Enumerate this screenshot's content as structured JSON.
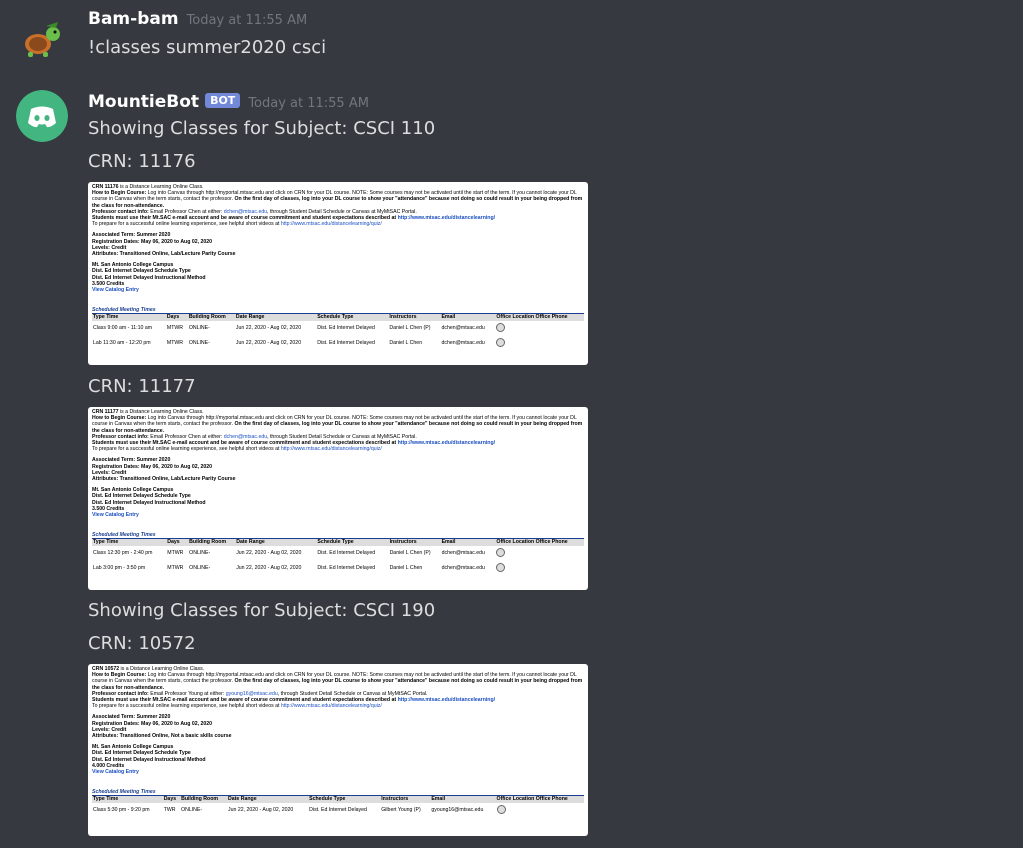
{
  "messages": [
    {
      "author": "Bam-bam",
      "timestamp": "Today at 11:55 AM",
      "text": "!classes summer2020 csci"
    },
    {
      "author": "MountieBot",
      "badge": "BOT",
      "timestamp": "Today at 11:55 AM"
    }
  ],
  "headings": {
    "s1": "Showing Classes for Subject: CSCI 110",
    "c1": "CRN: 11176",
    "c2": "CRN: 11177",
    "s2": "Showing Classes for Subject: CSCI 190",
    "c3": "CRN: 10572"
  },
  "embed_common": {
    "how_begin_label": "How to Begin Course:",
    "how_begin_text": " Log into Canvas through http://myportal.mtsac.edu and click on CRN for your DL course. NOTE: Some courses may not be activated until the start of the term. If you cannot locate your DL course in Canvas when the term starts, contact the professor. ",
    "first_day": "On the first day of classes, log into your DL course to show your \"attendance\" because not doing so could result in your being dropped from the class for non-attendance.",
    "contact_label": "Professor contact info:",
    "students_must": "Students must use their Mt.SAC e-mail account and be aware of course commitment and student expectations described at ",
    "dl_link": "http://www.mtsac.edu/distancelearning/",
    "prepare": "To prepare for a successful online learning experience, see helpful short videos at ",
    "quiz_link": "http://www.mtsac.edu/distancelearning/quiz/",
    "assoc_term": "Associated Term: Summer 2020",
    "reg_dates": "Registration Dates: May 06, 2020 to Aug 02, 2020",
    "levels": "Levels: Credit",
    "campus": "Mt. San Antonio College Campus",
    "view_catalog": "View Catalog Entry",
    "sched_title": "Scheduled Meeting Times",
    "date_range": "Jun 22, 2020 - Aug 02, 2020",
    "headers": [
      "Type",
      "Time",
      "Days",
      "Building",
      "Room",
      "Date Range",
      "Schedule Type",
      "Instructors",
      "Email",
      "Office Location",
      "Office Phone"
    ]
  },
  "embeds": [
    {
      "crn_bold": "CRN 11176",
      "crn_rest": " is a Distance Learning Online Class.",
      "contact_text": " Email Professor Chen at either: ",
      "prof_email": "dchen@mtsac.edu",
      "contact_rest": ", through Student Detail Schedule or Canvas at MyMtSAC Portal.",
      "attributes": "Attributes: Transitioned Online, Lab/Lecture Parity Course",
      "dl_type1": "Dist. Ed Internet Delayed Schedule Type",
      "dl_type2": "Dist. Ed Internet Delayed Instructional Method",
      "credits": "3.500 Credits",
      "rows": [
        {
          "type": "Class",
          "time": "9:00 am - 11:10 am",
          "days": "MTWR",
          "building": "ONLINE-",
          "sched": "Dist. Ed Internet Delayed",
          "instr": "Daniel L Chen (P)",
          "email": "dchen@mtsac.edu"
        },
        {
          "type": "Lab",
          "time": "11:30 am - 12:20 pm",
          "days": "MTWR",
          "building": "ONLINE-",
          "sched": "Dist. Ed Internet Delayed",
          "instr": "Daniel L Chen",
          "email": "dchen@mtsac.edu"
        }
      ]
    },
    {
      "crn_bold": "CRN 11177",
      "crn_rest": " is a Distance Learning Online Class.",
      "contact_text": " Email Professor Chen at either: ",
      "prof_email": "dchen@mtsac.edu",
      "contact_rest": ", through Student Detail Schedule or Canvas at MyMtSAC Portal.",
      "attributes": "Attributes: Transitioned Online, Lab/Lecture Parity Course",
      "dl_type1": "Dist. Ed Internet Delayed Schedule Type",
      "dl_type2": "Dist. Ed Internet Delayed Instructional Method",
      "credits": "3.500 Credits",
      "rows": [
        {
          "type": "Class",
          "time": "12:30 pm - 2:40 pm",
          "days": "MTWR",
          "building": "ONLINE-",
          "sched": "Dist. Ed Internet Delayed",
          "instr": "Daniel L Chen (P)",
          "email": "dchen@mtsac.edu"
        },
        {
          "type": "Lab",
          "time": "3:00 pm - 3:50 pm",
          "days": "MTWR",
          "building": "ONLINE-",
          "sched": "Dist. Ed Internet Delayed",
          "instr": "Daniel L Chen",
          "email": "dchen@mtsac.edu"
        }
      ]
    },
    {
      "crn_bold": "CRN 10572",
      "crn_rest": " is a Distance Learning Online Class.",
      "contact_text": " Email Professor Young at either: ",
      "prof_email": "gyoung16@mtsac.edu",
      "contact_rest": ", through Student Detail Schedule or Canvas at MyMtSAC Portal.",
      "attributes": "Attributes: Transitioned Online, Not a basic skills course",
      "dl_type1": "Dist. Ed Internet Delayed Schedule Type",
      "dl_type2": "Dist. Ed Internet Delayed Instructional Method",
      "credits": "4.000 Credits",
      "rows": [
        {
          "type": "Class",
          "time": "5:30 pm - 9:20 pm",
          "days": "TWR",
          "building": "ONLINE-",
          "sched": "Dist. Ed Internet Delayed",
          "instr": "Gilbert Young (P)",
          "email": "gyoung16@mtsac.edu"
        }
      ]
    }
  ]
}
